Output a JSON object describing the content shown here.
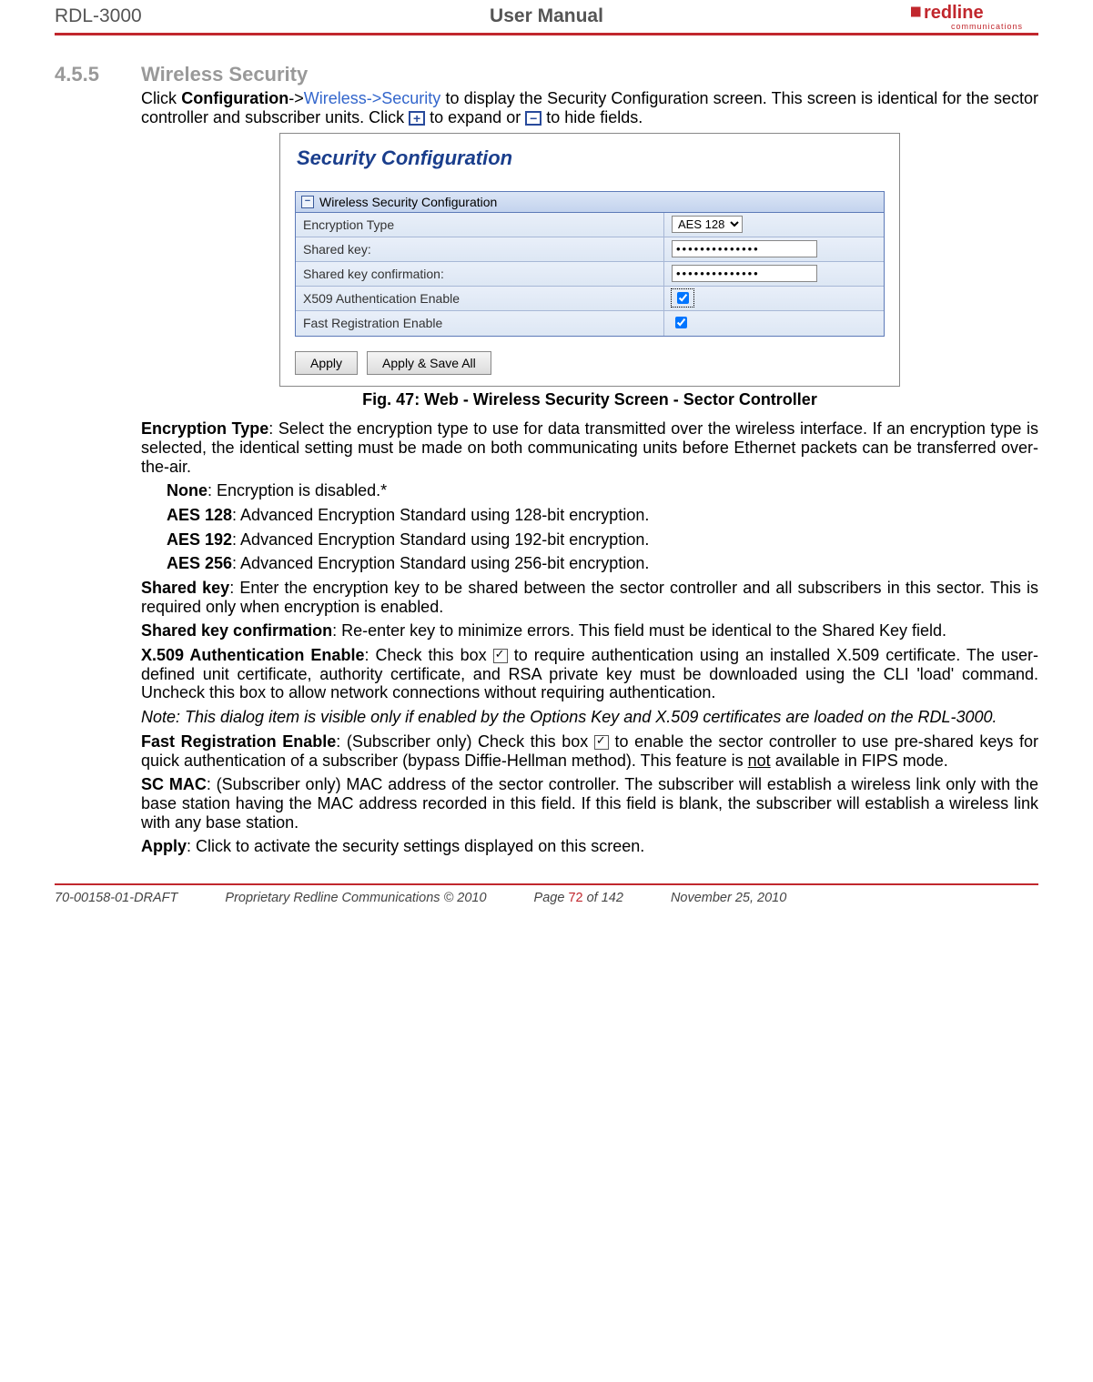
{
  "header": {
    "model": "RDL-3000",
    "title": "User Manual",
    "brand": "redline",
    "brand_sub": "communications"
  },
  "section": {
    "number": "4.5.5",
    "title": "Wireless Security"
  },
  "intro": {
    "pre": "Click ",
    "bold1": "Configuration",
    "dash": "->",
    "link": "Wireless->Security",
    "post1": " to display the Security Configuration screen. This screen is identical for the sector controller and subscriber units. Click ",
    "post2": " to expand or ",
    "post3": " to hide fields."
  },
  "screenshot": {
    "title": "Security Configuration",
    "panel_head": "Wireless Security Configuration",
    "rows": {
      "enc_type_label": "Encryption Type",
      "enc_type_value": "AES 128",
      "shared_key_label": "Shared key:",
      "shared_key_value": "••••••••••••••",
      "shared_key_conf_label": "Shared key confirmation:",
      "shared_key_conf_value": "••••••••••••••",
      "x509_label": "X509 Authentication Enable",
      "fast_reg_label": "Fast Registration Enable"
    },
    "buttons": {
      "apply": "Apply",
      "apply_save": "Apply & Save All"
    }
  },
  "figure": {
    "num": "Fig. 47",
    "caption": ": Web - Wireless Security Screen - Sector Controller"
  },
  "paras": {
    "enc_type_h": "Encryption Type",
    "enc_type_t": ": Select the encryption type to use for data transmitted over the wireless interface. If an encryption type is selected, the identical setting must be made on both communicating units before Ethernet packets can be transferred over-the-air.",
    "none_h": "None",
    "none_t": ": Encryption is disabled.*",
    "aes128_h": "AES 128",
    "aes128_t": ": Advanced Encryption Standard using 128-bit encryption.",
    "aes192_h": "AES 192",
    "aes192_t": ": Advanced Encryption Standard using 192-bit encryption.",
    "aes256_h": "AES 256",
    "aes256_t": ": Advanced Encryption Standard using 256-bit encryption.",
    "shared_h": "Shared key",
    "shared_t": ": Enter the encryption key to be shared between the sector controller and all subscribers in this sector. This is required only when encryption is enabled.",
    "sharedc_h": "Shared key confirmation",
    "sharedc_t": ": Re-enter key to minimize errors. This field must be identical to the Shared Key field.",
    "x509_h": "X.509 Authentication Enable",
    "x509_t1": ": Check this box ",
    "x509_t2": " to require authentication using an installed X.509 certificate. The user-defined unit certificate, authority certificate, and RSA private key must be downloaded using the CLI 'load' command. Uncheck this box to allow network connections without requiring authentication.",
    "x509_note": "Note: This dialog item is visible only if enabled by the Options Key and X.509 certificates are loaded on the RDL-3000.",
    "fast_h": "Fast Registration Enable",
    "fast_t1": ": (Subscriber only) Check this box ",
    "fast_t2": " to enable the sector controller to use pre-shared keys for quick authentication of a subscriber (bypass Diffie-Hellman method). This feature is ",
    "fast_not": "not",
    "fast_t3": " available in FIPS mode.",
    "scmac_h": "SC MAC",
    "scmac_t": ": (Subscriber only) MAC address of the sector controller. The subscriber will establish a wireless link only with the base station having the MAC address recorded in this field. If this field is blank, the subscriber will establish a wireless link with any base station.",
    "apply_h": "Apply",
    "apply_t": ": Click to activate the security settings displayed on this screen."
  },
  "footer": {
    "docnum": "70-00158-01-DRAFT",
    "copyright": "Proprietary Redline Communications © 2010",
    "page_pre": "Page ",
    "page_cur": "72",
    "page_of": " of 142",
    "date": "November 25, 2010"
  }
}
